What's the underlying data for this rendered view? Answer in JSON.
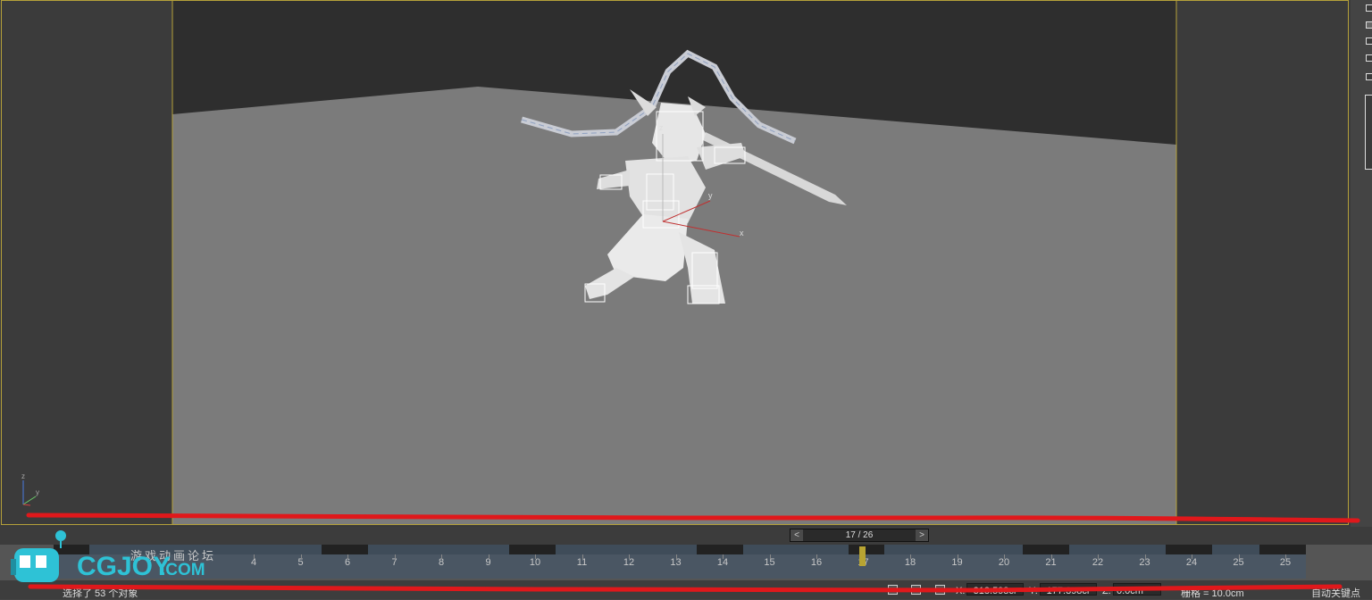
{
  "viewport": {
    "axis_labels": {
      "z": "z",
      "y": "y",
      "x": "x"
    },
    "gizmo_labels": {
      "z": "z",
      "y": "y",
      "x": "x"
    },
    "colors": {
      "frame": "#b5a13a",
      "floor": "#7b7b7b",
      "sky": "#2e2e2e",
      "model": "#e8e8e8"
    }
  },
  "frame_counter": {
    "text": "17 / 26",
    "prev": "<",
    "next": ">"
  },
  "timeline": {
    "ticks": [
      "4",
      "5",
      "6",
      "7",
      "8",
      "9",
      "10",
      "11",
      "12",
      "13",
      "14",
      "15",
      "16",
      "17",
      "18",
      "19",
      "20",
      "21",
      "22",
      "23",
      "24",
      "25",
      "25"
    ],
    "current_frame": 17
  },
  "status": {
    "selection_text": "选择了 53 个对象",
    "x_label": "X:",
    "x_value": "-318.598cr",
    "y_label": "Y:",
    "y_value": "-177.398cr",
    "z_label": "Z:",
    "z_value": "0.0cm",
    "grid_text": "栅格 = 10.0cm",
    "auto_key": "自动关键点"
  },
  "watermark": {
    "cn": "游戏动画论坛",
    "brand": "CGJOY",
    "suffix": ".COM"
  },
  "annotations": {
    "color": "#e0181b"
  }
}
